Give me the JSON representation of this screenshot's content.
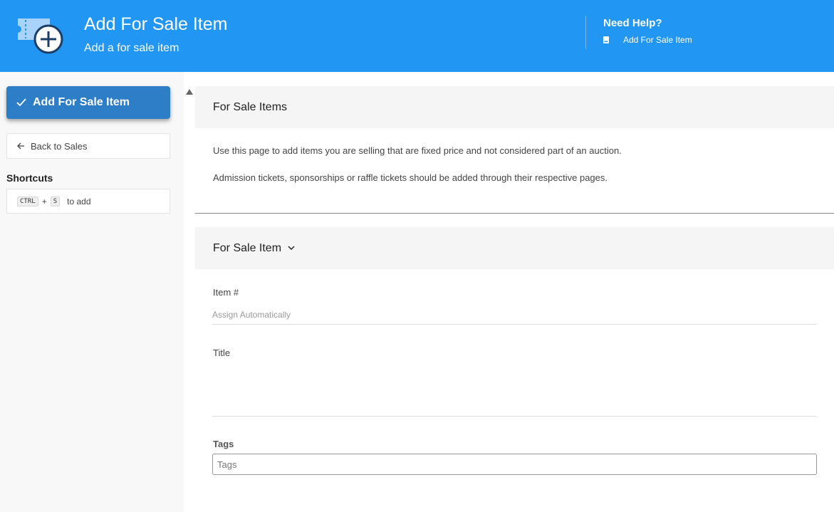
{
  "header": {
    "title": "Add For Sale Item",
    "subtitle": "Add a for sale item",
    "icon": "ticket-add-icon",
    "help_title": "Need Help?",
    "help_link": "Add For Sale Item",
    "background": "#2196f3"
  },
  "sidebar": {
    "primary_label": "Add For Sale Item",
    "primary_color": "#2d7ec7",
    "back_label": "Back to Sales",
    "shortcuts_title": "Shortcuts",
    "shortcut": {
      "key1": "CTRL",
      "plus": "+",
      "key2": "S",
      "action": "to add"
    }
  },
  "main": {
    "section1": {
      "title": "For Sale Items",
      "line1": "Use this page to add items you are selling that are fixed price and not considered part of an auction.",
      "line2": "Admission tickets, sponsorships or raffle tickets should be added through their respective pages."
    },
    "section2": {
      "title": "For Sale Item",
      "item_label": "Item #",
      "item_placeholder": "Assign Automatically",
      "title_label": "Title",
      "tags_label": "Tags",
      "tags_placeholder": "Tags"
    }
  }
}
